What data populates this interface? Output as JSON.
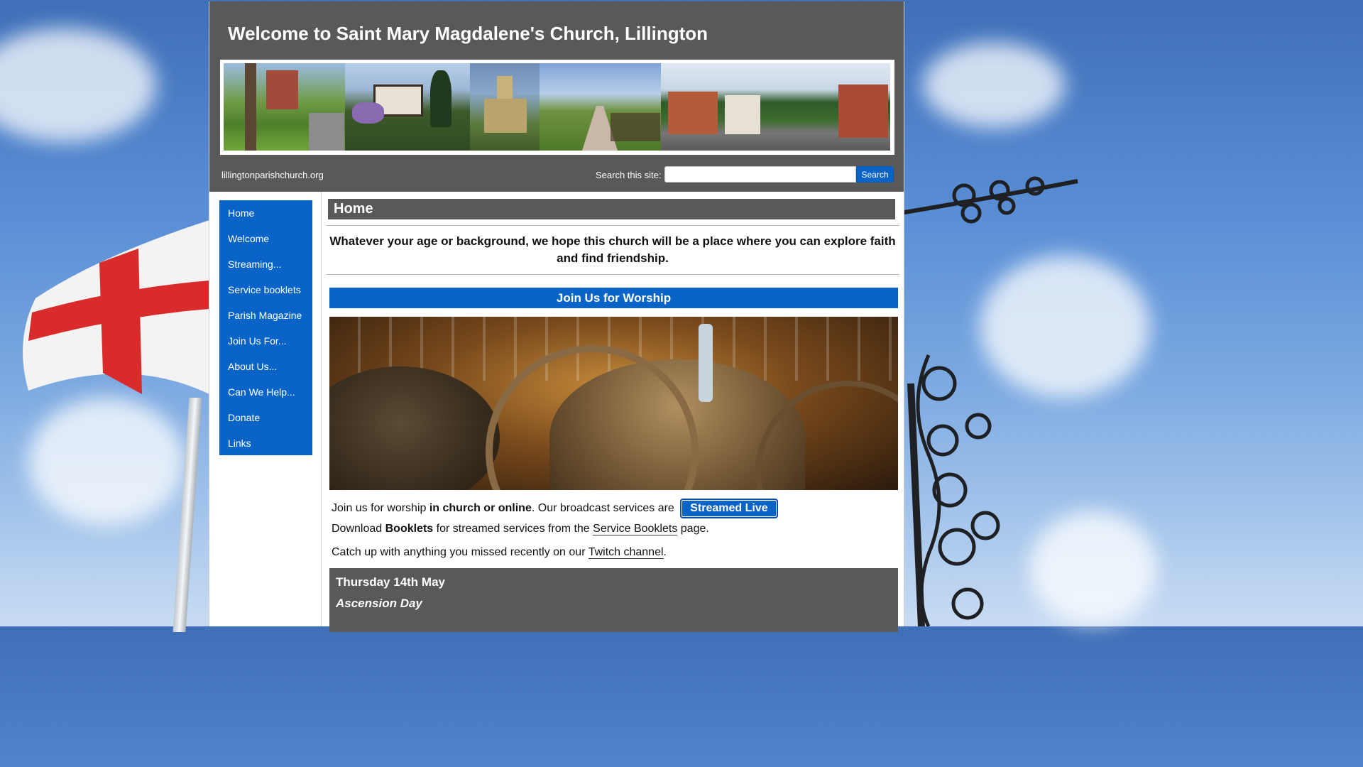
{
  "site": {
    "title": "Welcome to Saint Mary Magdalene's Church, Lillington",
    "domain": "lillingtonparishchurch.org"
  },
  "search": {
    "label": "Search this site:",
    "placeholder": "",
    "value": "",
    "button_label": "Search"
  },
  "sidebar": {
    "items": [
      {
        "label": "Home"
      },
      {
        "label": "Welcome"
      },
      {
        "label": "Streaming..."
      },
      {
        "label": "Service booklets"
      },
      {
        "label": "Parish Magazine"
      },
      {
        "label": "Join Us For..."
      },
      {
        "label": "About Us..."
      },
      {
        "label": "Can We Help..."
      },
      {
        "label": "Donate"
      },
      {
        "label": "Links"
      }
    ]
  },
  "main": {
    "heading": "Home",
    "intro": "Whatever your age or background, we hope this church will be a place where you can explore faith and find friendship.",
    "join_heading": "Join Us for Worship",
    "p1": {
      "a": "Join us for worship ",
      "b": "in church or online",
      "c": ". Our broadcast services are ",
      "button": "Streamed Live"
    },
    "p2": {
      "a": "Download ",
      "b": "Booklets",
      "c": " for streamed services from the ",
      "link": "Service Booklets",
      "d": " page."
    },
    "p3": {
      "a": "Catch up with anything you missed recently on our ",
      "link": "Twitch channel",
      "d": "."
    },
    "event": {
      "date": "Thursday 14th May",
      "name": "Ascension Day"
    }
  },
  "colors": {
    "header_bg": "#595959",
    "accent_blue": "#0a64c8"
  }
}
